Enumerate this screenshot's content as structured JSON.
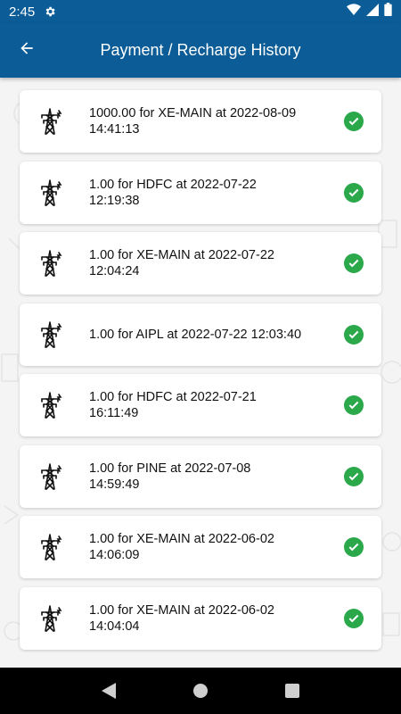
{
  "status_bar": {
    "time": "2:45",
    "icons": [
      "gear-icon",
      "wifi-icon",
      "signal-icon",
      "battery-icon"
    ]
  },
  "app_bar": {
    "title": "Payment / Recharge History",
    "back_icon": "arrow-back-icon"
  },
  "history": [
    {
      "text": "1000.00 for XE-MAIN at 2022-08-09 14:41:13",
      "status_icon": "check-circle-icon"
    },
    {
      "text": "1.00 for HDFC at 2022-07-22 12:19:38",
      "status_icon": "check-circle-icon"
    },
    {
      "text": "1.00 for XE-MAIN at 2022-07-22 12:04:24",
      "status_icon": "check-circle-icon"
    },
    {
      "text": "1.00 for AIPL at 2022-07-22 12:03:40",
      "status_icon": "check-circle-icon"
    },
    {
      "text": "1.00 for HDFC at 2022-07-21 16:11:49",
      "status_icon": "check-circle-icon"
    },
    {
      "text": "1.00 for PINE at 2022-07-08 14:59:49",
      "status_icon": "check-circle-icon"
    },
    {
      "text": "1.00 for XE-MAIN at 2022-06-02 14:06:09",
      "status_icon": "check-circle-icon"
    },
    {
      "text": "1.00 for XE-MAIN at 2022-06-02 14:04:04",
      "status_icon": "check-circle-icon"
    }
  ],
  "nav_bar": {
    "icons": [
      "nav-back-icon",
      "nav-home-icon",
      "nav-recents-icon"
    ]
  },
  "colors": {
    "primary": "#0b5c97",
    "success": "#2aa84a",
    "background": "#f4f4f4",
    "card": "#ffffff"
  }
}
